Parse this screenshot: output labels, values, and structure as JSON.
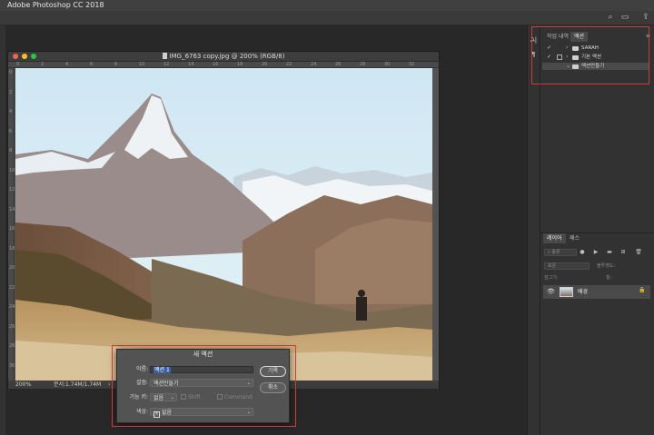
{
  "app": {
    "title": "Adobe Photoshop CC 2018"
  },
  "document": {
    "title": "IMG_6763 copy.jpg @ 200% (RGB/8)",
    "zoom": "200%",
    "doc_info": "문서:1.74M/1.74M",
    "ruler_ticks": [
      "0",
      "2",
      "4",
      "6",
      "8",
      "10",
      "12",
      "14",
      "16",
      "18",
      "20",
      "22",
      "24",
      "26",
      "28",
      "30",
      "32"
    ]
  },
  "panels": {
    "tabs": {
      "history": "작업 내역",
      "actions": "액션"
    },
    "actions": [
      {
        "name": "SARAH",
        "checked": true,
        "expanded": false
      },
      {
        "name": "기본 액션",
        "checked": true,
        "expanded": false
      },
      {
        "name": "액션만들기",
        "checked": false,
        "expanded": true
      }
    ],
    "layer_tabs": {
      "layers": "레이어",
      "paths": "패스"
    },
    "layer_filter": "종류",
    "blend_mode": "표준",
    "opacity_label": "불투명도:",
    "lock_label": "잠그기:",
    "fill_label": "칠:",
    "layer_name": "배경"
  },
  "dialog": {
    "title": "새 액션",
    "name_label": "이름:",
    "name_value": "액션 1",
    "set_label": "설정:",
    "set_value": "액션만들기",
    "fkey_label": "기능 키:",
    "fkey_value": "없음",
    "shift_label": "Shift",
    "command_label": "Command",
    "color_label": "색상:",
    "color_value": "없음",
    "color_icon": "x-icon",
    "record_button": "기록",
    "cancel_button": "취소"
  },
  "colors": {
    "highlight": "#d03a3a",
    "selection": "#3b5fa6"
  }
}
